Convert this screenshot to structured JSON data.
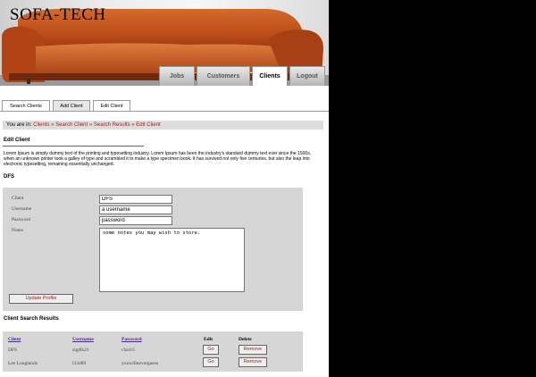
{
  "header": {
    "logo": "SOFA-TECH",
    "nav": [
      {
        "label": "Jobs"
      },
      {
        "label": "Customers"
      },
      {
        "label": "Clients"
      },
      {
        "label": "Logout"
      }
    ]
  },
  "subtabs": [
    {
      "label": "Search Clients"
    },
    {
      "label": "Add Client"
    },
    {
      "label": "Edit Client"
    }
  ],
  "breadcrumb": {
    "prefix": "You are in:",
    "items": [
      "Clients",
      "Search Client",
      "Search Results",
      "Edit Client"
    ],
    "separator": "»"
  },
  "edit": {
    "title": "Edit Client",
    "intro": "Lorem Ipsum is simply dummy text of the printing and typesetting industry. Lorem Ipsum has been the industry's standard dummy text ever since the 1500s, when an unknown printer took a galley of type and scrambled it to make a type specimen book. It has survived not only five centuries, but also the leap into electronic typesetting, remaining essentially unchanged.",
    "client_heading": "DFS"
  },
  "form": {
    "client_label": "Client",
    "client_value": "DFS",
    "username_label": "Username",
    "username_value": "a username",
    "password_label": "Password",
    "password_value": "password",
    "notes_label": "Notes",
    "notes_value": "some notes you may wish to store.",
    "update_button": "Update Profile"
  },
  "results": {
    "heading": "Client Search Results",
    "columns": [
      "Client",
      "Username",
      "Password",
      "Edit",
      "Delete"
    ],
    "rows": [
      {
        "client": "DFS",
        "username": "sigdfs21",
        "password": "cha1r5",
        "edit": "Go",
        "delete": "Remove"
      },
      {
        "client": "Lee Longlands",
        "username": "l33d89",
        "password": "youwillneverguess",
        "edit": "Go",
        "delete": "Remove"
      }
    ]
  },
  "colors": {
    "link_red": "#9b1b1b",
    "sofa_orange": "#c4541c",
    "panel_gray": "#d6d6d6"
  }
}
